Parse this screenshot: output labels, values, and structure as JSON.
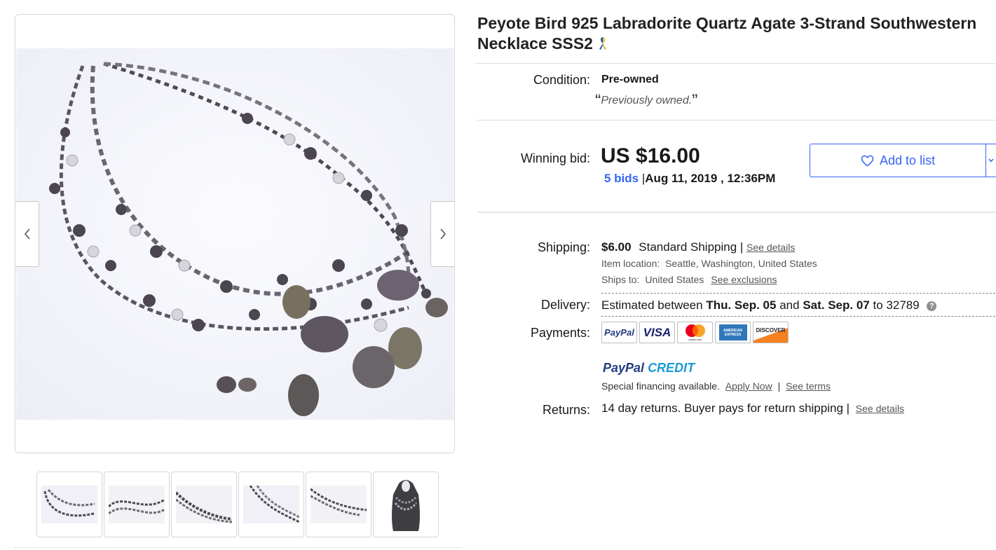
{
  "listing": {
    "title": "Peyote Bird 925 Labradorite Quartz Agate 3-Strand Southwestern Necklace SSS2",
    "ribbon_icon": "awareness-ribbon-icon"
  },
  "gallery": {
    "prev_icon": "chevron-left-icon",
    "next_icon": "chevron-right-icon",
    "thumbnail_count": 6
  },
  "condition": {
    "label": "Condition:",
    "value": "Pre-owned",
    "open_quote": "“",
    "note": "Previously owned.",
    "close_quote": "”"
  },
  "bid": {
    "label": "Winning bid:",
    "price": "US $16.00",
    "bids": "5 bids",
    "separator": "|",
    "date": "Aug 11, 2019 , 12:36PM",
    "add_to_list": "Add to list",
    "heart_icon": "heart-icon"
  },
  "shipping": {
    "label": "Shipping:",
    "price": "$6.00",
    "service": "Standard Shipping |",
    "details_link": "See details",
    "location_label": "Item location:",
    "location": "Seattle, Washington, United States",
    "ships_to_label": "Ships to:",
    "ships_to": "United States",
    "exclusions_link": "See exclusions"
  },
  "delivery": {
    "label": "Delivery:",
    "prefix": "Estimated between",
    "start": "Thu. Sep. 05",
    "and": "and",
    "end": "Sat. Sep. 07",
    "to": "to",
    "zip": "32789",
    "help": "?"
  },
  "payments": {
    "label": "Payments:",
    "methods": [
      "PayPal",
      "VISA",
      "mastercard",
      "AMERICAN EXPRESS",
      "DISCOVER"
    ],
    "paypal_credit_1": "PayPal",
    "paypal_credit_2": "CREDIT",
    "financing": "Special financing available.",
    "apply_link": "Apply Now",
    "pipe": "|",
    "terms_link": "See terms"
  },
  "returns": {
    "label": "Returns:",
    "text": "14 day returns. Buyer pays for return shipping |",
    "details_link": "See details"
  },
  "colors": {
    "link_blue": "#3665f3",
    "paypal_navy": "#253b80",
    "paypal_light": "#179bd7"
  }
}
